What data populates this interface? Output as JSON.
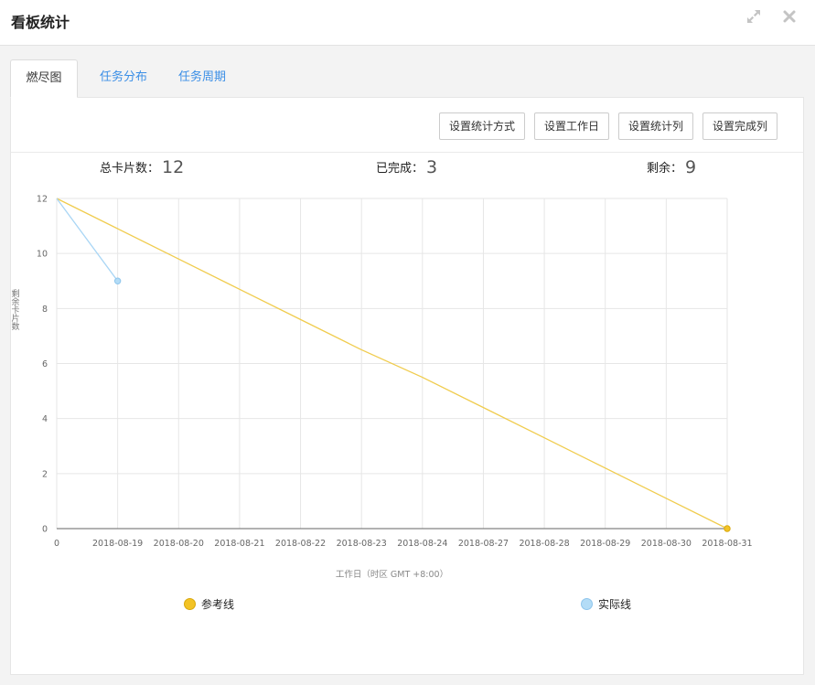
{
  "dialog": {
    "title": "看板统计"
  },
  "tabs": [
    {
      "label": "燃尽图",
      "active": true
    },
    {
      "label": "任务分布",
      "active": false
    },
    {
      "label": "任务周期",
      "active": false
    }
  ],
  "toolbar": {
    "buttons": [
      "设置统计方式",
      "设置工作日",
      "设置统计列",
      "设置完成列"
    ]
  },
  "stats": {
    "total_label": "总卡片数：",
    "total_value": "12",
    "done_label": "已完成：",
    "done_value": "3",
    "remain_label": "剩余：",
    "remain_value": "9"
  },
  "colors": {
    "reference": "#f0cc4e",
    "reference_fill": "#f3c325",
    "actual": "#a9d6f5",
    "actual_fill": "#b3dcf6",
    "tab_link": "#3a8ee6"
  },
  "icons": {
    "expand": "expand-icon",
    "close": "close-icon"
  },
  "chart_data": {
    "type": "line",
    "ylabel": "剩余卡片数",
    "xlabel": "工作日（时区 GMT +8:00）",
    "categories": [
      "0",
      "2018-08-19",
      "2018-08-20",
      "2018-08-21",
      "2018-08-22",
      "2018-08-23",
      "2018-08-24",
      "2018-08-27",
      "2018-08-28",
      "2018-08-29",
      "2018-08-30",
      "2018-08-31"
    ],
    "ylim": [
      0,
      12
    ],
    "yticks": [
      0,
      2,
      4,
      6,
      8,
      10,
      12
    ],
    "grid": true,
    "legend_position": "bottom",
    "series": [
      {
        "name": "参考线",
        "values": [
          12,
          10.9,
          9.8,
          8.7,
          7.6,
          6.5,
          5.5,
          4.4,
          3.3,
          2.2,
          1.1,
          0
        ]
      },
      {
        "name": "实际线",
        "values": [
          12,
          9,
          null,
          null,
          null,
          null,
          null,
          null,
          null,
          null,
          null,
          null
        ]
      }
    ]
  }
}
